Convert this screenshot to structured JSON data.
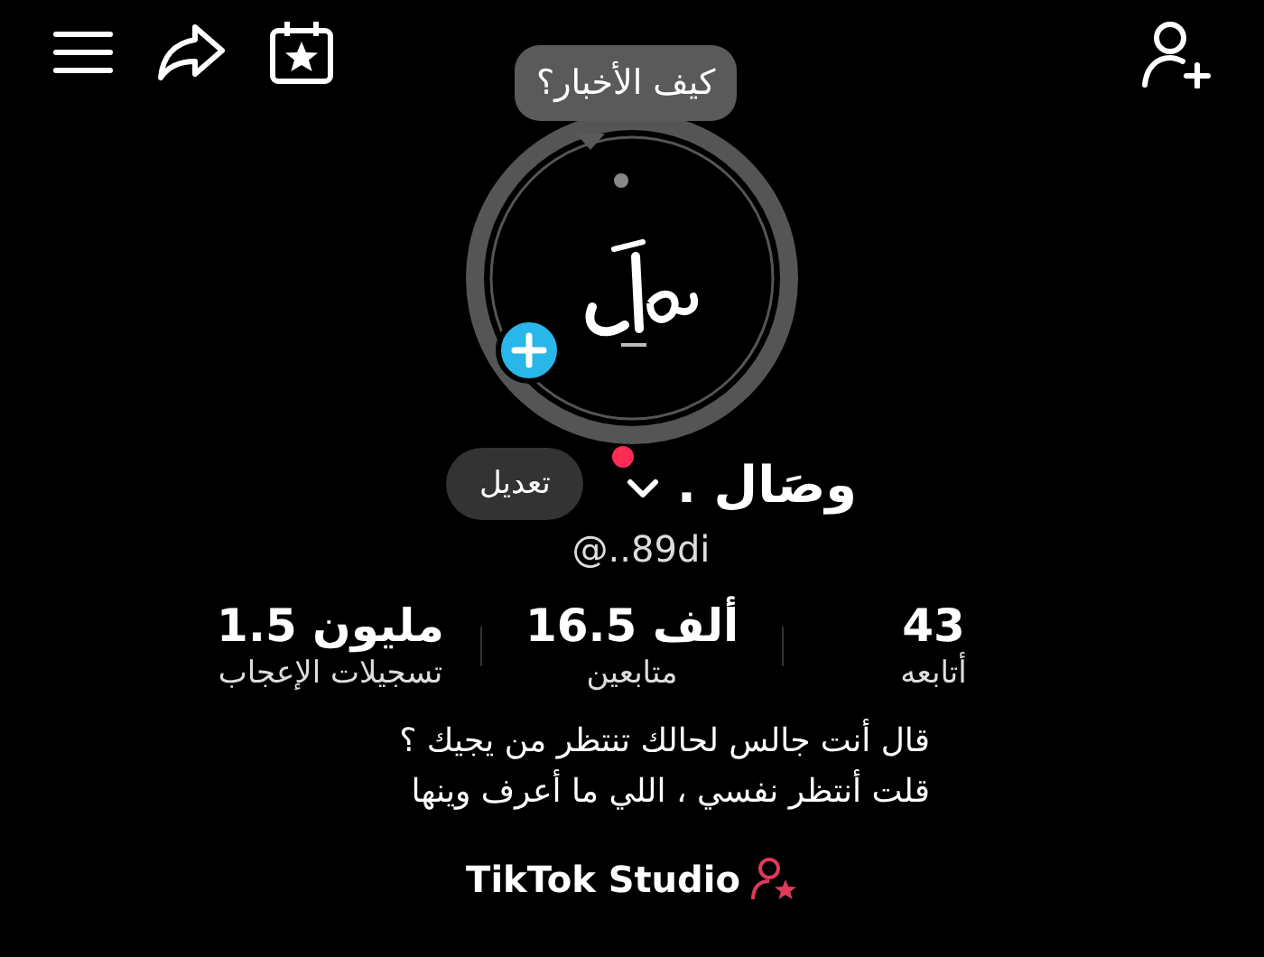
{
  "status_bubble": {
    "text": "كيف الأخبار؟"
  },
  "profile": {
    "name": "وصَال .",
    "handle": "@..89di",
    "edit_button": "تعديل"
  },
  "stats": [
    {
      "value": "43",
      "label": "أتابعه"
    },
    {
      "value": "16.5 ألف",
      "label": "متابعين"
    },
    {
      "value": "1.5 مليون",
      "label": "تسجيلات الإعجاب"
    }
  ],
  "bio": [
    "قال أنت جالس لحالك تنتظر من يجيك ؟",
    "قلت أنتظر نفسي ، اللي ما أعرف وينها"
  ],
  "studio_link": {
    "label": "TikTok Studio"
  }
}
